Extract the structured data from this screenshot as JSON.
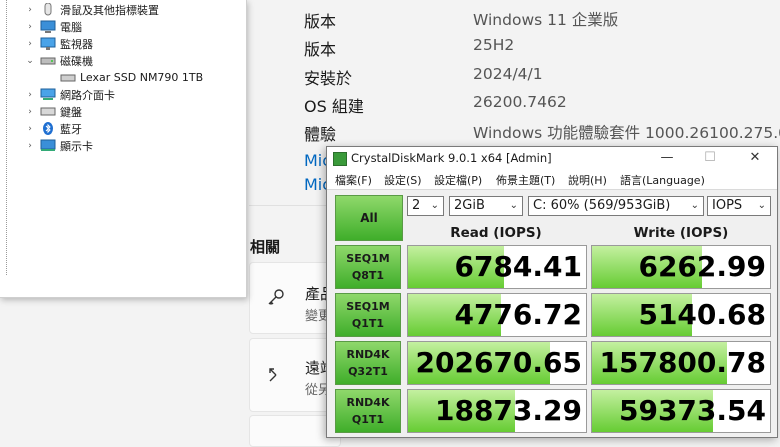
{
  "settings": {
    "specs": [
      {
        "label": "版本",
        "value": "Windows 11 企業版"
      },
      {
        "label": "版本",
        "value": "25H2"
      },
      {
        "label": "安裝於",
        "value": "2024/4/1"
      },
      {
        "label": "OS 組建",
        "value": "26200.7462"
      },
      {
        "label": "體驗",
        "value": "Windows 功能體驗套件 1000.26100.275.0"
      }
    ],
    "links": [
      "Mic",
      "Mic"
    ],
    "related_heading": "相關",
    "cards": [
      {
        "icon": "key-icon",
        "title": "產品",
        "sub": "變更"
      },
      {
        "icon": "remote-desktop-icon",
        "title": "遠端",
        "sub": "從另"
      },
      {
        "icon": "",
        "title": "",
        "sub": ""
      }
    ]
  },
  "device_manager": {
    "items": [
      {
        "label": "滑鼠及其他指標裝置",
        "arrow": "›",
        "icon": "mouse-icon"
      },
      {
        "label": "電腦",
        "arrow": "›",
        "icon": "computer-icon"
      },
      {
        "label": "監視器",
        "arrow": "›",
        "icon": "monitor-icon"
      },
      {
        "label": "磁碟機",
        "arrow": "⌄",
        "icon": "disk-drive-icon"
      },
      {
        "label": "Lexar SSD NM790 1TB",
        "arrow": "",
        "icon": "disk-icon"
      },
      {
        "label": "網路介面卡",
        "arrow": "›",
        "icon": "network-icon"
      },
      {
        "label": "鍵盤",
        "arrow": "›",
        "icon": "keyboard-icon"
      },
      {
        "label": "藍牙",
        "arrow": "›",
        "icon": "bluetooth-icon"
      },
      {
        "label": "顯示卡",
        "arrow": "›",
        "icon": "display-adapter-icon"
      }
    ]
  },
  "cdm": {
    "title": "CrystalDiskMark 9.0.1 x64 [Admin]",
    "window_buttons": {
      "minimize": "—",
      "maximize": "☐",
      "close": "✕"
    },
    "menu": [
      "檔案(F)",
      "設定(S)",
      "設定檔(P)",
      "佈景主題(T)",
      "說明(H)",
      "語言(Language)"
    ],
    "all_label": "All",
    "count": "2",
    "size": "2GiB",
    "drive": "C: 60% (569/953GiB)",
    "unit": "IOPS",
    "read_header": "Read (IOPS)",
    "write_header": "Write (IOPS)",
    "tests": [
      {
        "line1": "SEQ1M",
        "line2": "Q8T1",
        "read": "6784.41",
        "write": "6262.99",
        "read_fill": 0.54,
        "write_fill": 0.62
      },
      {
        "line1": "SEQ1M",
        "line2": "Q1T1",
        "read": "4776.72",
        "write": "5140.68",
        "read_fill": 0.52,
        "write_fill": 0.56
      },
      {
        "line1": "RND4K",
        "line2": "Q32T1",
        "read": "202670.65",
        "write": "157800.78",
        "read_fill": 0.8,
        "write_fill": 0.76
      },
      {
        "line1": "RND4K",
        "line2": "Q1T1",
        "read": "18873.29",
        "write": "59373.54",
        "read_fill": 0.6,
        "write_fill": 0.68
      }
    ],
    "colors": {
      "bar_fill": "#66cc33",
      "button": "#3fae2a"
    }
  }
}
